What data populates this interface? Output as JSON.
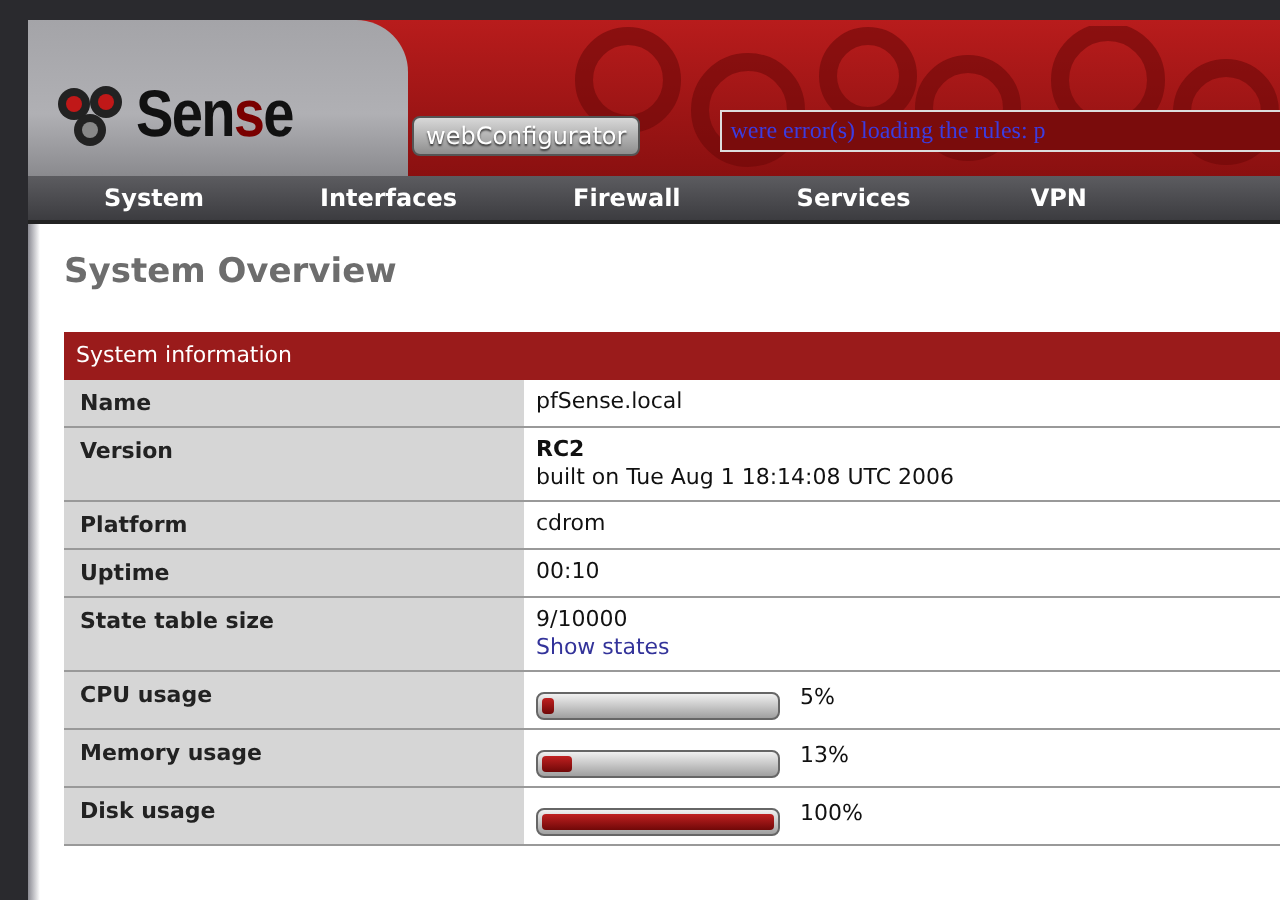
{
  "header": {
    "logo": {
      "before": "Sen",
      "accent": "s",
      "after": "e"
    },
    "subtitle": "webConfigurator",
    "alert": "were error(s) loading the rules: p"
  },
  "nav": [
    {
      "label": "System"
    },
    {
      "label": "Interfaces"
    },
    {
      "label": "Firewall"
    },
    {
      "label": "Services"
    },
    {
      "label": "VPN"
    }
  ],
  "page_title": "System Overview",
  "panel": {
    "title": "System information",
    "rows": [
      {
        "label": "Name",
        "kind": "text",
        "lines": [
          {
            "text": "pfSense.local",
            "kind": "plain"
          }
        ]
      },
      {
        "label": "Version",
        "kind": "text",
        "lines": [
          {
            "text": "RC2",
            "kind": "strong"
          },
          {
            "text": "built on Tue Aug 1 18:14:08 UTC 2006",
            "kind": "plain"
          }
        ]
      },
      {
        "label": "Platform",
        "kind": "text",
        "lines": [
          {
            "text": "cdrom",
            "kind": "plain"
          }
        ]
      },
      {
        "label": "Uptime",
        "kind": "text",
        "lines": [
          {
            "text": "00:10",
            "kind": "plain"
          }
        ]
      },
      {
        "label": "State table size",
        "kind": "text",
        "lines": [
          {
            "text": "9/10000",
            "kind": "plain"
          },
          {
            "text": "Show states",
            "kind": "link"
          }
        ]
      },
      {
        "label": "CPU usage",
        "kind": "bar",
        "level": 0.05,
        "reading": "5%"
      },
      {
        "label": "Memory usage",
        "kind": "bar",
        "level": 0.13,
        "reading": "13%"
      },
      {
        "label": "Disk usage",
        "kind": "bar",
        "level": 1,
        "reading": "100%"
      }
    ]
  }
}
